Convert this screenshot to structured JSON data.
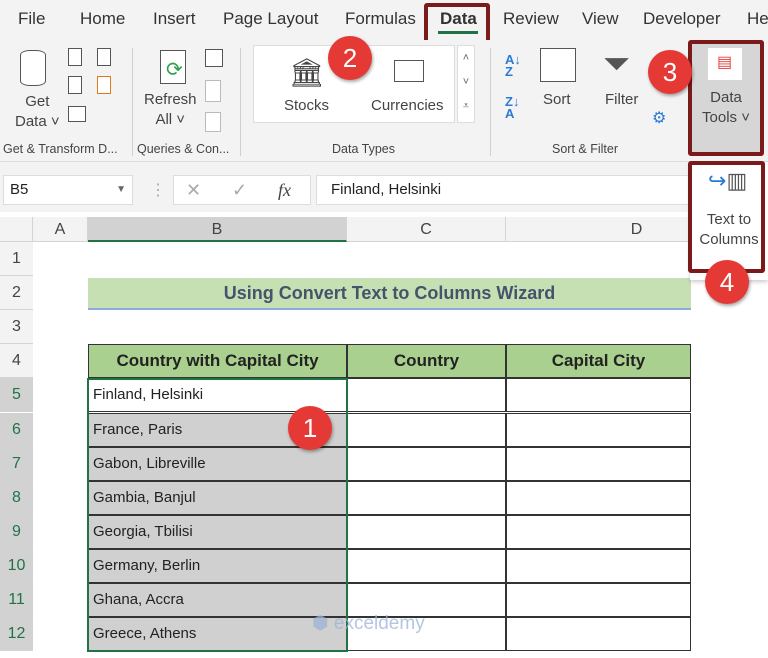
{
  "menu": {
    "tabs": [
      "File",
      "Home",
      "Insert",
      "Page Layout",
      "Formulas",
      "Data",
      "Review",
      "View",
      "Developer",
      "He"
    ],
    "active": "Data"
  },
  "ribbon": {
    "get_data": "Get",
    "get_data2": "Data",
    "refresh": "Refresh",
    "refresh2": "All",
    "stocks": "Stocks",
    "currencies": "Currencies",
    "sort": "Sort",
    "filter": "Filter",
    "data_tools": "Data",
    "data_tools2": "Tools",
    "text_to_columns": "Text to",
    "text_to_columns2": "Columns",
    "groups": [
      "Get & Transform D...",
      "Queries & Con...",
      "Data Types",
      "Sort & Filter"
    ]
  },
  "formula_bar": {
    "name_box": "B5",
    "fx": "fx",
    "value": "Finland, Helsinki"
  },
  "columns": [
    "A",
    "B",
    "C",
    "D"
  ],
  "rows": [
    "1",
    "2",
    "3",
    "4",
    "5",
    "6",
    "7",
    "8",
    "9",
    "10",
    "11",
    "12"
  ],
  "sheet": {
    "title": "Using Convert Text to Columns Wizard",
    "headers": [
      "Country with Capital City",
      "Country",
      "Capital City"
    ],
    "values": [
      "Finland, Helsinki",
      "France, Paris",
      "Gabon, Libreville",
      "Gambia, Banjul",
      "Georgia, Tbilisi",
      "Germany, Berlin",
      "Ghana, Accra",
      "Greece, Athens"
    ]
  },
  "badges": [
    "1",
    "2",
    "3",
    "4"
  ],
  "watermark": "exceldemy",
  "colors": {
    "header_green": "#a9d08e",
    "title_green": "#c6e0b4",
    "selection": "#d0d0d0",
    "badge": "#e53935",
    "highlight": "#7b1a1a",
    "excel_green": "#217346"
  }
}
